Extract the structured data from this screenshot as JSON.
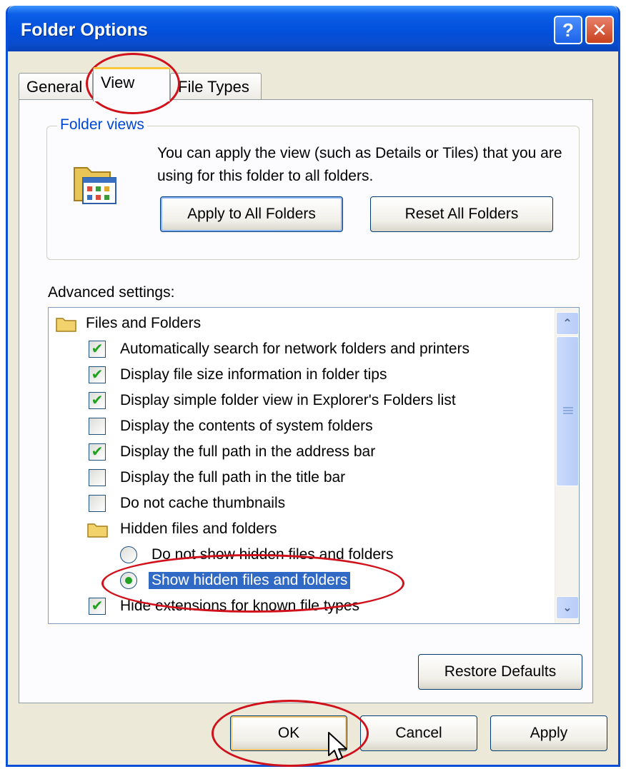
{
  "window": {
    "title": "Folder Options",
    "help_glyph": "?",
    "close_glyph": "✕"
  },
  "tabs": [
    {
      "label": "General"
    },
    {
      "label": "View"
    },
    {
      "label": "File Types"
    }
  ],
  "folder_views": {
    "group_label": "Folder views",
    "description": "You can apply the view (such as Details or Tiles) that you are using for this folder to all folders.",
    "apply_all_label": "Apply to All Folders",
    "reset_all_label": "Reset All Folders"
  },
  "advanced": {
    "label": "Advanced settings:",
    "items": [
      {
        "type": "folder",
        "label": "Files and Folders"
      },
      {
        "type": "checkbox",
        "checked": true,
        "label": "Automatically search for network folders and printers"
      },
      {
        "type": "checkbox",
        "checked": true,
        "label": "Display file size information in folder tips"
      },
      {
        "type": "checkbox",
        "checked": true,
        "label": "Display simple folder view in Explorer's Folders list"
      },
      {
        "type": "checkbox",
        "checked": false,
        "label": "Display the contents of system folders"
      },
      {
        "type": "checkbox",
        "checked": true,
        "label": "Display the full path in the address bar"
      },
      {
        "type": "checkbox",
        "checked": false,
        "label": "Display the full path in the title bar"
      },
      {
        "type": "checkbox",
        "checked": false,
        "label": "Do not cache thumbnails"
      },
      {
        "type": "folder",
        "label": "Hidden files and folders"
      },
      {
        "type": "radio",
        "selected": false,
        "label": "Do not show hidden files and folders"
      },
      {
        "type": "radio",
        "selected": true,
        "label": "Show hidden files and folders"
      },
      {
        "type": "checkbox",
        "checked": true,
        "label": "Hide extensions for known file types"
      }
    ],
    "check_glyph": "✔"
  },
  "buttons": {
    "restore_defaults": "Restore Defaults",
    "ok": "OK",
    "cancel": "Cancel",
    "apply": "Apply"
  },
  "scrollbar": {
    "up_glyph": "⌃",
    "down_glyph": "⌄"
  },
  "colors": {
    "titlebar": "#0350dc",
    "dialog_bg": "#ece9d8",
    "selection": "#316ac5",
    "annotation": "#d0101a",
    "check": "#21a121"
  }
}
